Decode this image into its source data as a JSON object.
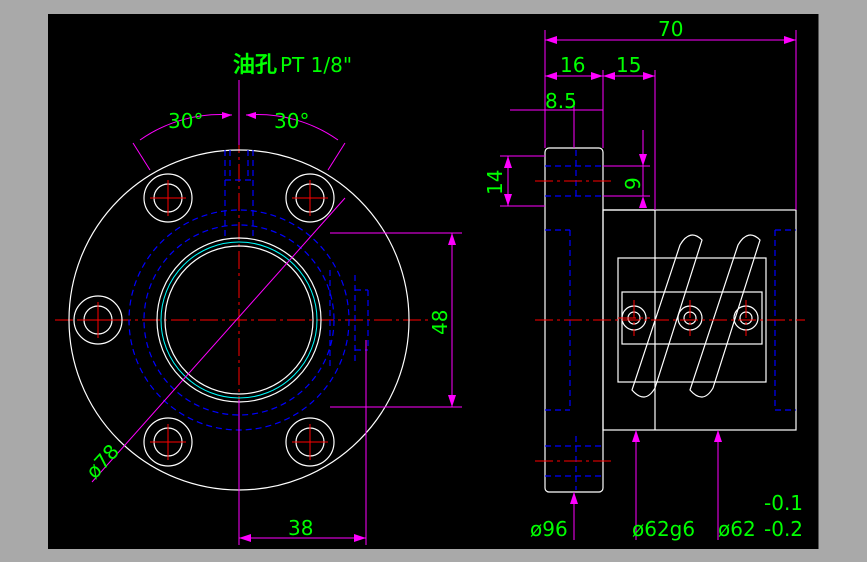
{
  "drawing": {
    "title": {
      "cn": "油孔",
      "spec": "PT 1/8\""
    },
    "front_view": {
      "angle_left": "30°",
      "angle_right": "30°",
      "height_dim": "48",
      "width_dim": "38",
      "diameter_dim": "ø78"
    },
    "side_view": {
      "total_length": "70",
      "flange_thickness": "16",
      "gap": "15",
      "half_thickness": "8.5",
      "counterbore_dia": "14",
      "hole_dia": "9",
      "flange_dia": "ø96",
      "body_dia": "ø62g6",
      "body_dia2": "ø62",
      "tol_upper": "-0.1",
      "tol_lower": "-0.2"
    },
    "colors": {
      "background": "#000000",
      "outline": "#ffffff",
      "dimension": "#ff00ff",
      "text": "#00ff00",
      "hidden": "#0000ff",
      "center": "#ff0000",
      "thread": "#00ffff"
    }
  }
}
